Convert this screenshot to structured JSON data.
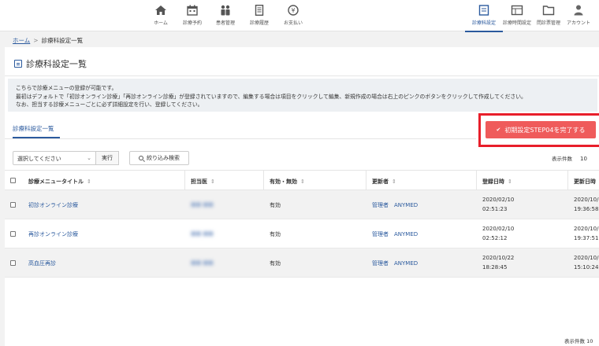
{
  "nav": {
    "items": [
      {
        "label": "ホーム",
        "icon": "home-icon"
      },
      {
        "label": "診療予約",
        "icon": "calendar-icon"
      },
      {
        "label": "患者管理",
        "icon": "patients-icon"
      },
      {
        "label": "診療履歴",
        "icon": "document-icon"
      },
      {
        "label": "お支払い",
        "icon": "yen-coin-icon"
      }
    ],
    "right_items": [
      {
        "label": "診療科設定",
        "icon": "list-icon"
      },
      {
        "label": "診療時間設定",
        "icon": "schedule-icon"
      },
      {
        "label": "問診票管理",
        "icon": "folder-icon"
      },
      {
        "label": "アカウント",
        "icon": "user-icon"
      }
    ]
  },
  "breadcrumb": {
    "home": "ホーム",
    "separator": ">",
    "current": "診療科設定一覧"
  },
  "page": {
    "title": "診療科設定一覧"
  },
  "notice": {
    "lines": [
      "こちらで診療メニューの登録が可能です。",
      "最初はデフォルトで「初診オンライン診療」「再診オンライン診療」が登録されていますので、編集する場合は項目をクリックして編集、新規作成の場合は右上のピンクのボタンをクリックして作成してください。",
      "なお、担当する診療メニューごとに必ず詳細設定を行い、登録してください。"
    ]
  },
  "tab": {
    "label": "診療科設定一覧"
  },
  "complete_button": {
    "label": "初期設定STEP04を完了する",
    "check": "✔"
  },
  "controls": {
    "select_value": "選択してください",
    "run_label": "実行",
    "filter_label": "絞り込み検索",
    "per_page_label": "表示件数",
    "per_page_value": "10"
  },
  "table": {
    "headers": {
      "title": "診療メニュータイトル",
      "doctor": "担当医",
      "status": "有効・無効",
      "updater": "更新者",
      "registered": "登録日時",
      "updated": "更新日時"
    },
    "sort_glyph": "⇕",
    "rows": [
      {
        "title": "初診オンライン診療",
        "doctor": "■■ ■■",
        "status": "有効",
        "updater": "管理者　ANYMED",
        "reg_date": "2020/02/10",
        "reg_time": "02:51:23",
        "upd_date": "2020/10/",
        "upd_time": "19:36:58"
      },
      {
        "title": "再診オンライン診療",
        "doctor": "■■ ■■",
        "status": "有効",
        "updater": "管理者　ANYMED",
        "reg_date": "2020/02/10",
        "reg_time": "02:52:12",
        "upd_date": "2020/10/",
        "upd_time": "19:37:51"
      },
      {
        "title": "高血圧再診",
        "doctor": "■■ ■■",
        "status": "有効",
        "updater": "管理者　ANYMED",
        "reg_date": "2020/10/22",
        "reg_time": "18:28:45",
        "upd_date": "2020/10/",
        "upd_time": "15:10:24"
      }
    ]
  },
  "footer": {
    "per_page_label": "表示件数",
    "per_page_value": "10"
  },
  "colors": {
    "accent": "#2b5a9e",
    "complete_button": "#ef5b5b",
    "highlight_border": "#e81e2a",
    "notice_bg": "#edf0f3"
  }
}
